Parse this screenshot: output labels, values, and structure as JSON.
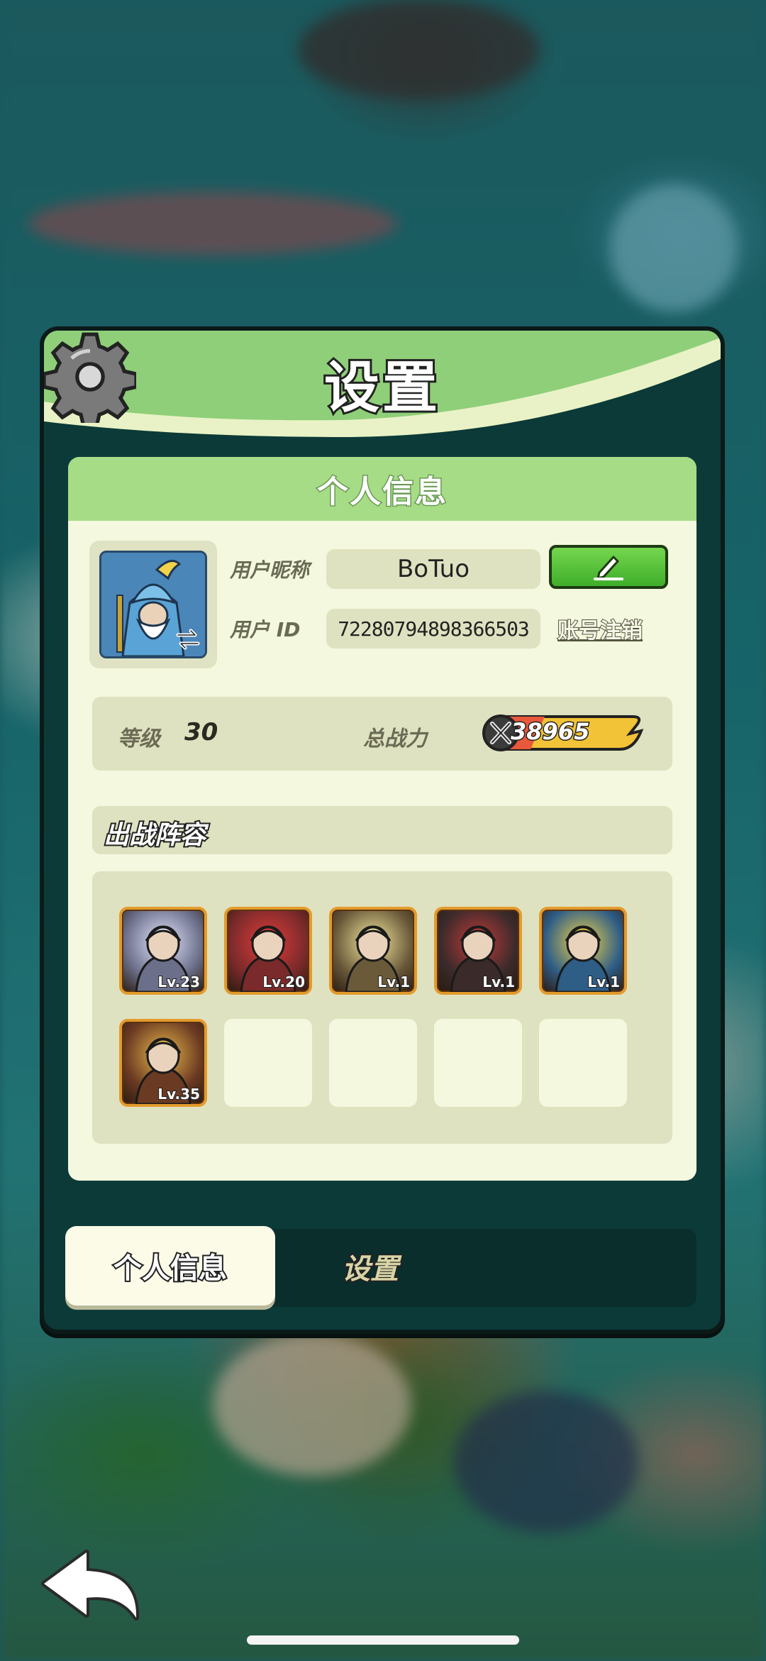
{
  "dialog": {
    "title": "设置",
    "section_title": "个人信息"
  },
  "profile": {
    "nickname_label": "用户昵称",
    "nickname": "BoTuo",
    "uid_label": "用户  ID",
    "uid": "72280794898366503",
    "account_cancel_label": "账号注销",
    "level_label": "等级",
    "level": "30",
    "power_label": "总战力",
    "power": "38965"
  },
  "lineup": {
    "title": "出战阵容",
    "heroes": [
      {
        "level": "Lv.23",
        "theme": "#6b6f8a",
        "accent": "#e6e6ff"
      },
      {
        "level": "Lv.20",
        "theme": "#7a2a2a",
        "accent": "#e23b3b"
      },
      {
        "level": "Lv.1",
        "theme": "#6a5a3a",
        "accent": "#f6e9a0"
      },
      {
        "level": "Lv.1",
        "theme": "#3a2a2a",
        "accent": "#c23a3a"
      },
      {
        "level": "Lv.1",
        "theme": "#2e5d86",
        "accent": "#f0d34a"
      },
      {
        "level": "Lv.35",
        "theme": "#6b3a22",
        "accent": "#e8b84a"
      }
    ],
    "empty_slots": 4
  },
  "tabs": {
    "active": "个人信息",
    "inactive": "设置"
  },
  "colors": {
    "header_green": "#8fcf79",
    "panel_cream": "#f3f8de",
    "hero_border": "#e39b2c"
  }
}
